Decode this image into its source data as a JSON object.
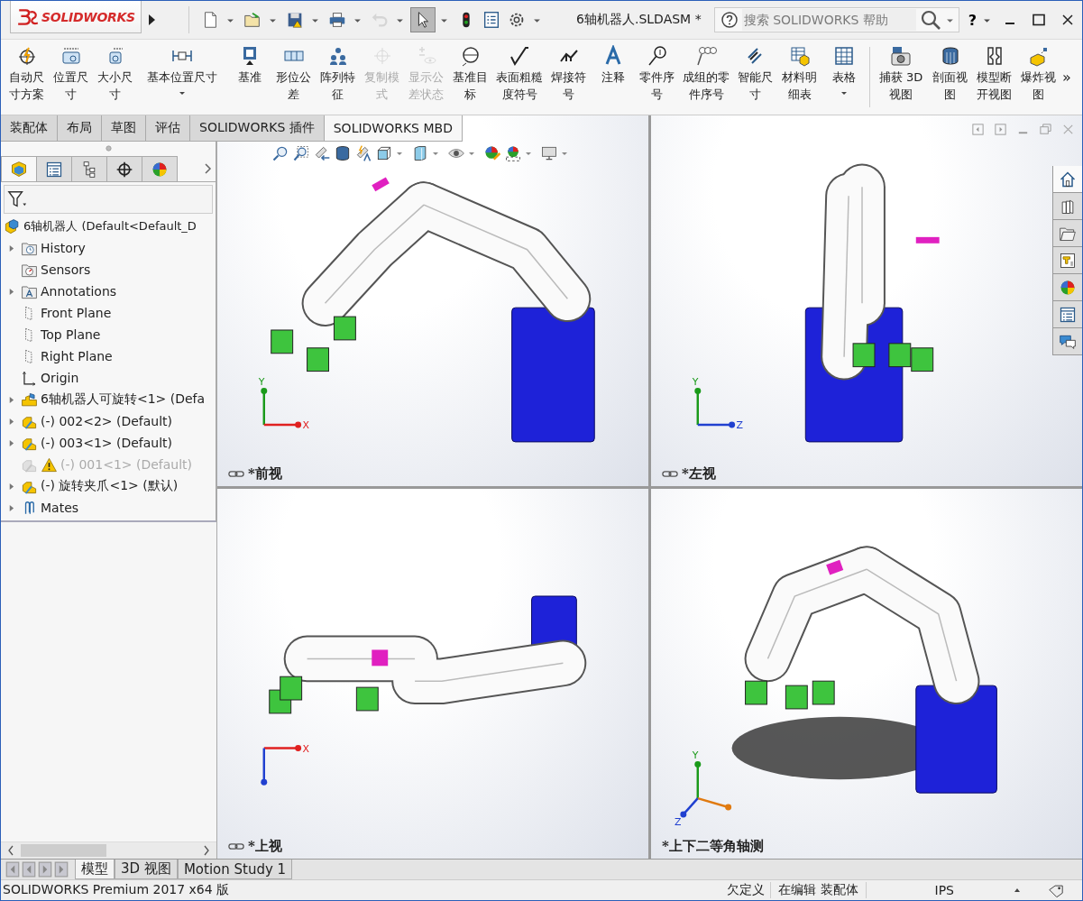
{
  "title_bar": {
    "logo": "SOLIDWORKS",
    "quick_access": [
      {
        "kind": "new",
        "dropdown": true,
        "disabled": false,
        "pressed": false
      },
      {
        "kind": "open",
        "dropdown": true,
        "disabled": false,
        "pressed": false
      },
      {
        "kind": "save",
        "dropdown": true,
        "disabled": false,
        "pressed": false
      },
      {
        "kind": "print",
        "dropdown": true,
        "disabled": false,
        "pressed": false
      },
      {
        "kind": "undo",
        "dropdown": true,
        "disabled": true,
        "pressed": false
      },
      {
        "kind": "select",
        "dropdown": true,
        "disabled": false,
        "pressed": true
      },
      {
        "kind": "rebuild",
        "dropdown": false,
        "disabled": false,
        "pressed": false
      },
      {
        "kind": "properties",
        "dropdown": false,
        "disabled": false,
        "pressed": false
      },
      {
        "kind": "options",
        "dropdown": true,
        "disabled": false,
        "pressed": false
      }
    ],
    "title": "6轴机器人.SLDASM *",
    "search": {
      "placeholder": "搜索 SOLIDWORKS 帮助"
    },
    "help": "?"
  },
  "ribbon": {
    "groups": [
      [
        {
          "label": "自动尺寸方案",
          "kind": "auto",
          "disabled": false,
          "dropdown": false
        },
        {
          "label": "位置尺寸",
          "kind": "location",
          "disabled": false,
          "dropdown": false
        },
        {
          "label": "大小尺寸",
          "kind": "size",
          "disabled": false,
          "dropdown": false
        },
        {
          "label": "基本位置尺寸",
          "kind": "basic",
          "disabled": false,
          "dropdown": true
        },
        {
          "label": "基准",
          "kind": "datum",
          "disabled": false,
          "dropdown": false
        },
        {
          "label": "形位公差",
          "kind": "tolerance",
          "disabled": false,
          "dropdown": false
        },
        {
          "label": "阵列特征",
          "kind": "pattern",
          "disabled": false,
          "dropdown": false
        },
        {
          "label": "复制模式",
          "kind": "copy",
          "disabled": true,
          "dropdown": false
        },
        {
          "label": "显示公差状态",
          "kind": "status",
          "disabled": true,
          "dropdown": false
        },
        {
          "label": "基准目标",
          "kind": "target",
          "disabled": false,
          "dropdown": false
        },
        {
          "label": "表面粗糙度符号",
          "kind": "surface",
          "disabled": false,
          "dropdown": false
        },
        {
          "label": "焊接符号",
          "kind": "weld",
          "disabled": false,
          "dropdown": false
        },
        {
          "label": "注释",
          "kind": "note",
          "disabled": false,
          "dropdown": false
        },
        {
          "label": "零件序号",
          "kind": "balloon",
          "disabled": false,
          "dropdown": false
        },
        {
          "label": "成组的零件序号",
          "kind": "stack",
          "disabled": false,
          "dropdown": false
        },
        {
          "label": "智能尺寸",
          "kind": "smart",
          "disabled": false,
          "dropdown": false
        },
        {
          "label": "材料明细表",
          "kind": "bom",
          "disabled": false,
          "dropdown": false
        },
        {
          "label": "表格",
          "kind": "table",
          "disabled": false,
          "dropdown": true
        }
      ],
      [
        {
          "label": "捕获 3D 视图",
          "kind": "capture",
          "disabled": false,
          "dropdown": false
        },
        {
          "label": "剖面视图",
          "kind": "section",
          "disabled": false,
          "dropdown": false
        },
        {
          "label": "模型断开视图",
          "kind": "break",
          "disabled": false,
          "dropdown": false
        },
        {
          "label": "爆炸视图",
          "kind": "explode",
          "disabled": false,
          "dropdown": false
        }
      ]
    ],
    "overflow": "»"
  },
  "tabs": [
    {
      "label": "装配体",
      "selected": false
    },
    {
      "label": "布局",
      "selected": false
    },
    {
      "label": "草图",
      "selected": false
    },
    {
      "label": "评估",
      "selected": false
    },
    {
      "label": "SOLIDWORKS 插件",
      "selected": false
    },
    {
      "label": "SOLIDWORKS MBD",
      "selected": true
    }
  ],
  "feature_manager": {
    "panel_tabs": [
      {
        "kind": "tree",
        "selected": true
      },
      {
        "kind": "property",
        "selected": false
      },
      {
        "kind": "config",
        "selected": false
      },
      {
        "kind": "dimxpert",
        "selected": false
      },
      {
        "kind": "display",
        "selected": false
      }
    ],
    "tree": {
      "label": "6轴机器人  (Default<Default_D",
      "kind": "assembly",
      "children": [
        {
          "label": "History",
          "kind": "history",
          "expandable": true,
          "suppressed": false,
          "warning": false
        },
        {
          "label": "Sensors",
          "kind": "sensors",
          "expandable": false,
          "suppressed": false,
          "warning": false
        },
        {
          "label": "Annotations",
          "kind": "annotations",
          "expandable": true,
          "suppressed": false,
          "warning": false
        },
        {
          "label": "Front Plane",
          "kind": "plane",
          "expandable": false,
          "suppressed": false,
          "warning": false
        },
        {
          "label": "Top Plane",
          "kind": "plane",
          "expandable": false,
          "suppressed": false,
          "warning": false
        },
        {
          "label": "Right Plane",
          "kind": "plane",
          "expandable": false,
          "suppressed": false,
          "warning": false
        },
        {
          "label": "Origin",
          "kind": "origin",
          "expandable": false,
          "suppressed": false,
          "warning": false
        },
        {
          "label": "6轴机器人可旋转<1> (Defa",
          "kind": "subassembly",
          "expandable": true,
          "suppressed": false,
          "warning": false
        },
        {
          "label": "(-) 002<2> (Default)",
          "kind": "part",
          "expandable": true,
          "suppressed": false,
          "warning": false
        },
        {
          "label": "(-) 003<1> (Default)",
          "kind": "part",
          "expandable": true,
          "suppressed": false,
          "warning": false
        },
        {
          "label": "(-) 001<1> (Default)",
          "kind": "part",
          "expandable": false,
          "suppressed": true,
          "warning": true
        },
        {
          "label": "(-) 旋转夹爪<1> (默认)",
          "kind": "part",
          "expandable": true,
          "suppressed": false,
          "warning": false
        },
        {
          "label": "Mates",
          "kind": "mates",
          "expandable": true,
          "suppressed": false,
          "warning": false
        }
      ]
    }
  },
  "viewports": [
    {
      "label": "*前视",
      "linked": true,
      "kind": "front",
      "axes": [
        {
          "label": "Y",
          "kind": "up",
          "color": "#1a9a1a"
        },
        {
          "label": "X",
          "kind": "right",
          "color": "#e02020"
        }
      ]
    },
    {
      "label": "*左视",
      "linked": true,
      "kind": "left",
      "axes": [
        {
          "label": "Y",
          "kind": "up",
          "color": "#1a9a1a"
        },
        {
          "label": "Z",
          "kind": "right",
          "color": "#2040d0"
        }
      ]
    },
    {
      "label": "*上视",
      "linked": true,
      "kind": "top",
      "axes": [
        {
          "label": "X",
          "kind": "right",
          "color": "#e02020"
        },
        {
          "kind": "down",
          "color": "#2040d0"
        }
      ]
    },
    {
      "label": "*上下二等角轴测",
      "linked": false,
      "kind": "iso",
      "axes": [
        {
          "label": "Y",
          "kind": "up",
          "color": "#1a9a1a"
        },
        {
          "kind": "iso-right",
          "color": "#e07a10"
        },
        {
          "label": "Z",
          "kind": "iso-left",
          "color": "#2040d0"
        }
      ]
    }
  ],
  "bottom_tabs": [
    {
      "label": "模型",
      "selected": true
    },
    {
      "label": "3D 视图",
      "selected": false
    },
    {
      "label": "Motion Study 1",
      "selected": false
    }
  ],
  "status_bar": {
    "product": "SOLIDWORKS Premium 2017 x64 版",
    "state": "欠定义",
    "mode": "在编辑 装配体",
    "units": "IPS"
  }
}
